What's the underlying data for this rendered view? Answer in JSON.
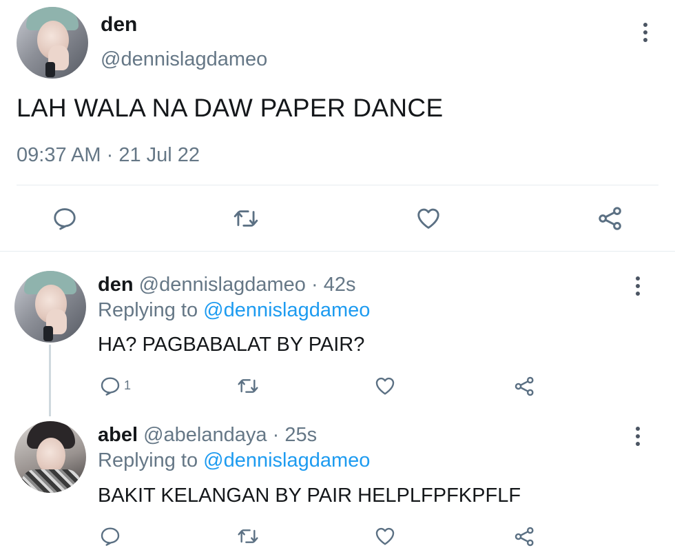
{
  "main_tweet": {
    "display_name": "den",
    "handle": "@dennislagdameo",
    "text": "LAH WALA NA DAW PAPER DANCE",
    "time": "09:37 AM",
    "separator": "·",
    "date": "21 Jul 22"
  },
  "replies": [
    {
      "display_name": "den",
      "handle": "@dennislagdameo",
      "dot": "·",
      "age": "42s",
      "replying_prefix": "Replying to",
      "replying_to": "@dennislagdameo",
      "text": "HA? PAGBABALAT BY PAIR?",
      "reply_count": "1"
    },
    {
      "display_name": "abel",
      "handle": "@abelandaya",
      "dot": "·",
      "age": "25s",
      "replying_prefix": "Replying to",
      "replying_to": "@dennislagdameo",
      "text": "BAKIT KELANGAN BY PAIR HELPLFPFKPFLF",
      "reply_count": ""
    }
  ],
  "icons": {
    "reply": "reply-icon",
    "retweet": "retweet-icon",
    "like": "like-icon",
    "share": "share-icon",
    "more": "more-icon"
  },
  "colors": {
    "link": "#1d9bf0",
    "muted": "#657786",
    "icon": "#5b7083",
    "divider": "#e6ecf0"
  }
}
